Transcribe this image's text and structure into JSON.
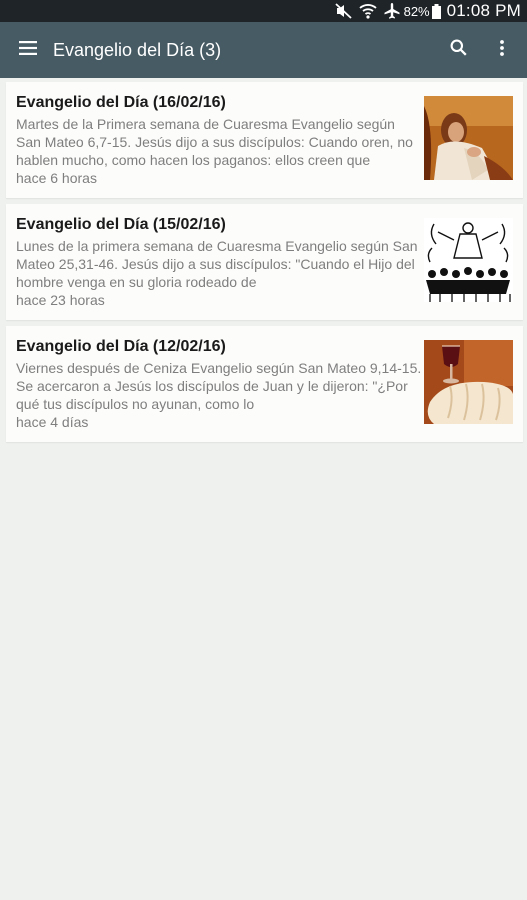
{
  "status": {
    "battery_percent": "82%",
    "time": "01:08 PM",
    "icons": [
      "mute-icon",
      "wifi-icon",
      "airplane-icon",
      "battery-icon"
    ]
  },
  "appbar": {
    "title": "Evangelio del Día (3)",
    "icons": [
      "hamburger-menu-icon",
      "search-icon",
      "overflow-menu-icon"
    ],
    "color": "#465b64"
  },
  "items": [
    {
      "title": "Evangelio del Día (16/02/16)",
      "excerpt": "Martes de la Primera semana de Cuaresma Evangelio según San Mateo 6,7-15. Jesús dijo a sus discípulos: Cuando oren, no hablen mucho, como hacen los paganos: ellos creen que",
      "time_ago": "hace 6 horas",
      "image": "praying-jesus-painting"
    },
    {
      "title": "Evangelio del Día (15/02/16)",
      "excerpt": "  Lunes de la primera semana de Cuaresma Evangelio según San Mateo 25,31-46.  Jesús dijo a sus discípulos: \"Cuando el Hijo del hombre venga en su gloria rodeado de",
      "time_ago": "hace 23 horas",
      "image": "christ-in-glory-line-drawing"
    },
    {
      "title": "Evangelio del Día (12/02/16)",
      "excerpt": "Viernes después de Ceniza Evangelio según San Mateo 9,14-15. Se acercaron a Jesús los discípulos de Juan y le dijeron: \"¿Por qué tus discípulos no ayunan, como lo",
      "time_ago": "hace 4 días",
      "image": "bread-and-wine-photo"
    }
  ]
}
